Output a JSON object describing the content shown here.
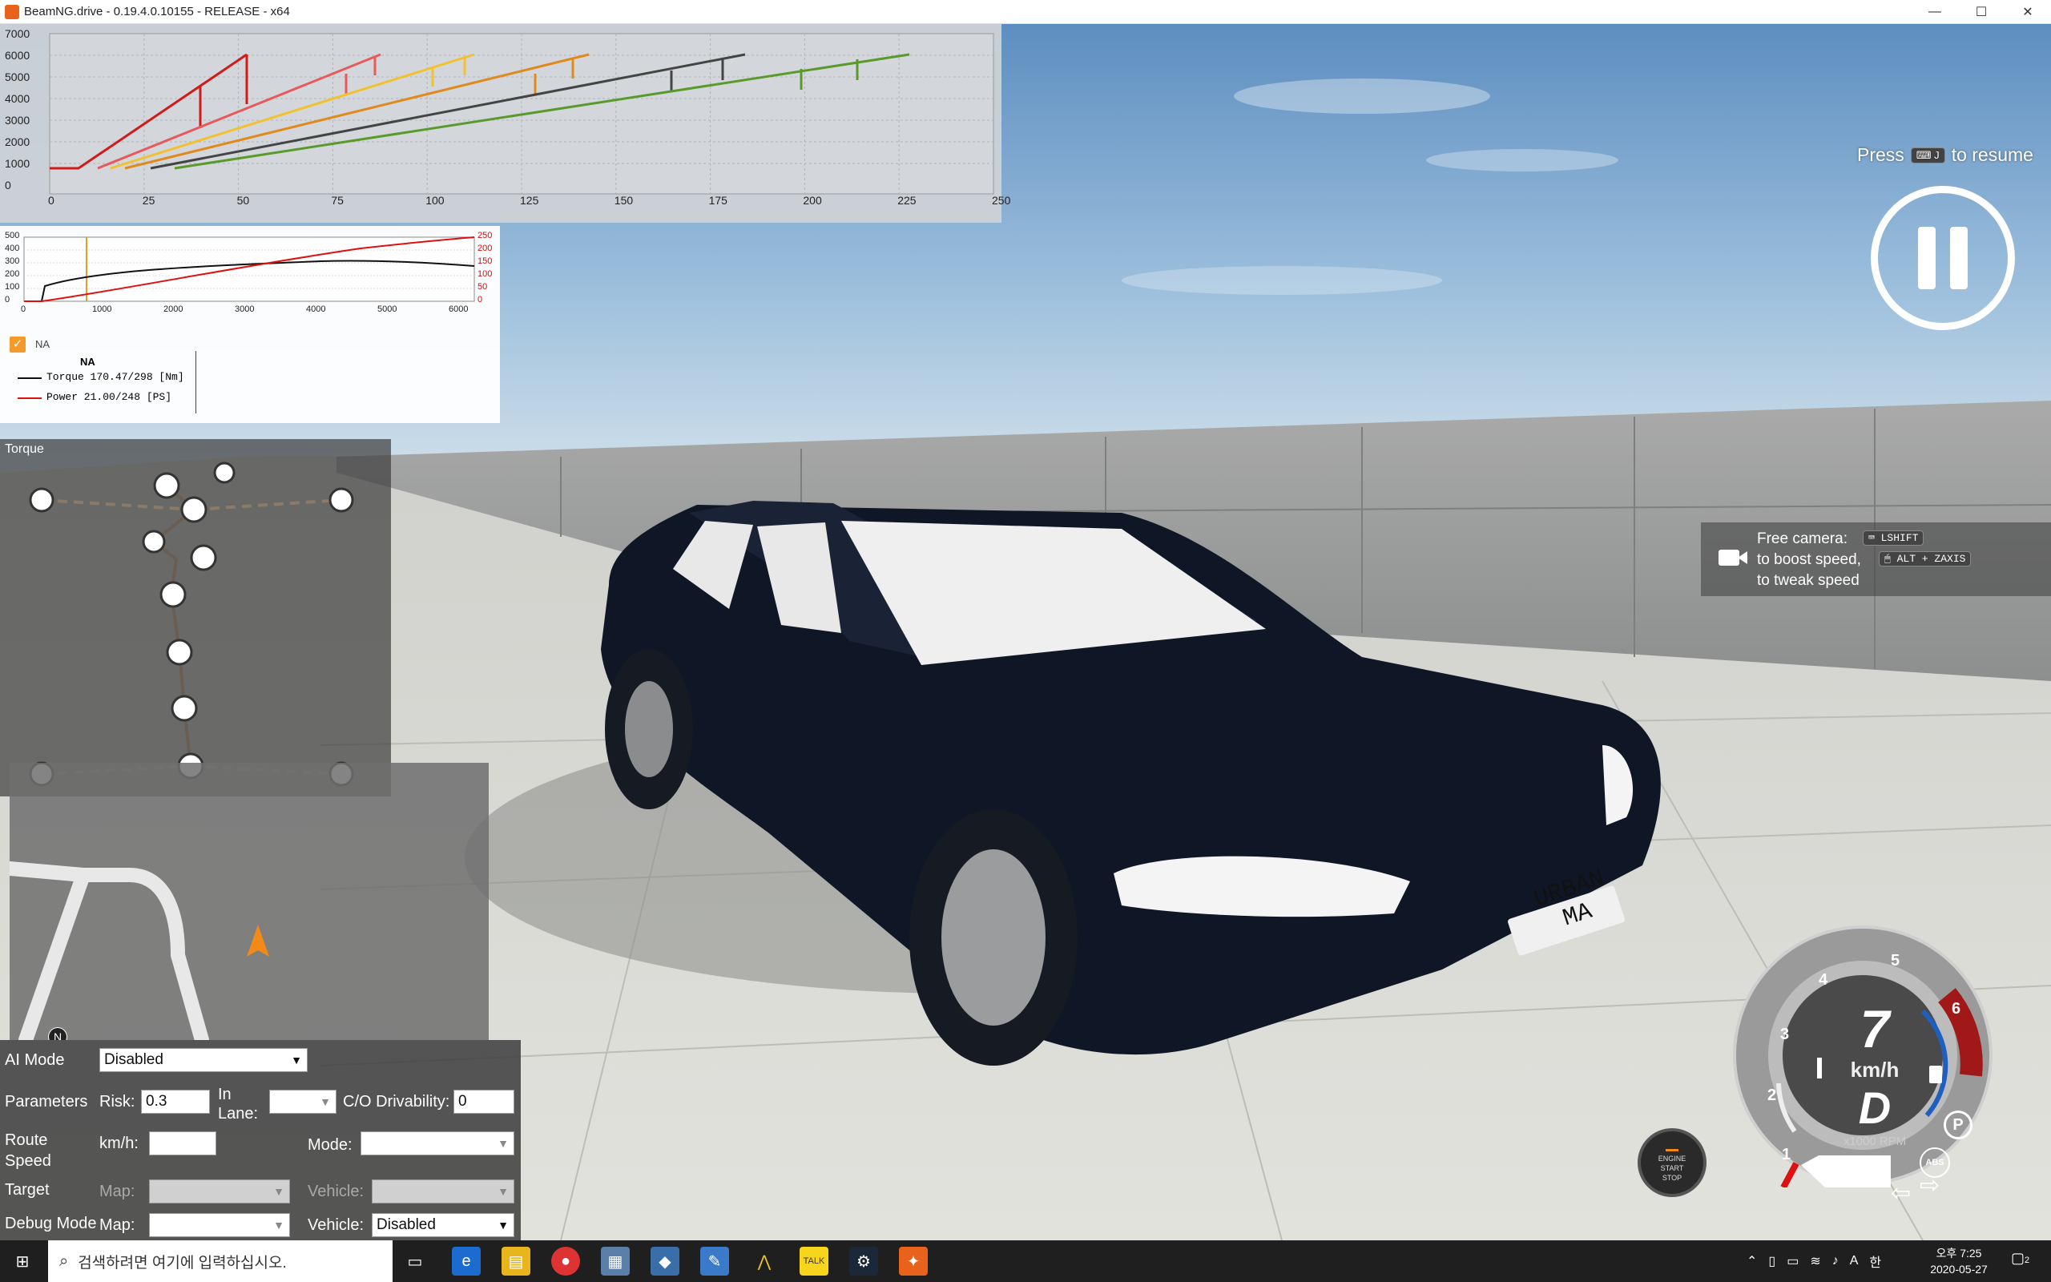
{
  "window": {
    "title": "BeamNG.drive - 0.19.4.0.10155 - RELEASE - x64",
    "minimize": "—",
    "maximize": "☐",
    "close": "✕"
  },
  "gearing_chart": {
    "y_ticks": [
      "7000",
      "6000",
      "5000",
      "4000",
      "3000",
      "2000",
      "1000",
      "0"
    ],
    "x_ticks": [
      "0",
      "25",
      "50",
      "75",
      "100",
      "125",
      "150",
      "175",
      "200",
      "225",
      "250"
    ],
    "colors": [
      "#d11a1a",
      "#e85a5a",
      "#f2c12e",
      "#e08a1e",
      "#444444",
      "#5a9a2a"
    ]
  },
  "torque_chart": {
    "left_ticks": [
      "500",
      "400",
      "300",
      "200",
      "100",
      "0"
    ],
    "right_ticks": [
      "250",
      "200",
      "150",
      "100",
      "50",
      "0"
    ],
    "x_ticks": [
      "0",
      "1000",
      "2000",
      "3000",
      "4000",
      "5000",
      "6000"
    ]
  },
  "legend": {
    "checkbox_label": "NA",
    "title": "NA",
    "torque": "Torque 170.47/298 [Nm]",
    "power": "Power  21.00/248  [PS]"
  },
  "powertrain": {
    "title": "Torque"
  },
  "minimap": {
    "north": "N"
  },
  "resume": {
    "press": "Press",
    "key": "⌨ J",
    "to_resume": "to resume"
  },
  "free_camera": {
    "line1": "Free camera:",
    "key1": "⌨ LSHIFT",
    "line2": "to boost speed,",
    "key2": "🖱 ALT + ZAXIS",
    "line3": "to tweak speed"
  },
  "ai": {
    "ai_mode_label": "AI Mode",
    "ai_mode_value": "Disabled",
    "parameters_label": "Parameters",
    "risk_label": "Risk:",
    "risk_value": "0.3",
    "in_lane_label": "In Lane:",
    "co_label": "C/O Drivability:",
    "co_value": "0",
    "route_speed_label": "Route Speed",
    "kmh_label": "km/h:",
    "mode_label": "Mode:",
    "target_label": "Target",
    "map_label": "Map:",
    "vehicle_label": "Vehicle:",
    "debug_label": "Debug Mode",
    "debug_map_label": "Map:",
    "debug_vehicle_label": "Vehicle:",
    "debug_vehicle_value": "Disabled"
  },
  "car": {
    "plate": "URBAN MA"
  },
  "engine_button": {
    "line1": "ENGINE",
    "line2": "START",
    "line3": "STOP"
  },
  "gauge": {
    "speed": "7",
    "unit": "km/h",
    "gear": "D",
    "rpm_label": "x1000 RPM",
    "ticks": [
      "1",
      "2",
      "3",
      "4",
      "5",
      "6"
    ],
    "abs": "ABS",
    "park": "P"
  },
  "taskbar": {
    "search_placeholder": "검색하려면 여기에 입력하십시오.",
    "time": "오후 7:25",
    "date": "2020-05-27",
    "lang": "A",
    "ime": "한",
    "notif": "2"
  }
}
